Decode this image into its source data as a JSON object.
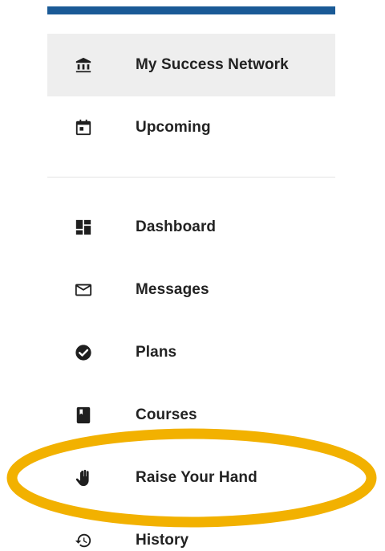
{
  "accent_color": "#1a5a96",
  "highlight_color": "#f2b100",
  "nav": {
    "primary": [
      {
        "label": "My Success Network",
        "icon": "bank-icon",
        "active": true
      },
      {
        "label": "Upcoming",
        "icon": "calendar-icon",
        "active": false
      }
    ],
    "secondary": [
      {
        "label": "Dashboard",
        "icon": "dashboard-icon"
      },
      {
        "label": "Messages",
        "icon": "envelope-icon"
      },
      {
        "label": "Plans",
        "icon": "check-circle-icon"
      },
      {
        "label": "Courses",
        "icon": "book-icon"
      },
      {
        "label": "Raise Your Hand",
        "icon": "hand-icon"
      },
      {
        "label": "History",
        "icon": "history-icon"
      }
    ]
  }
}
